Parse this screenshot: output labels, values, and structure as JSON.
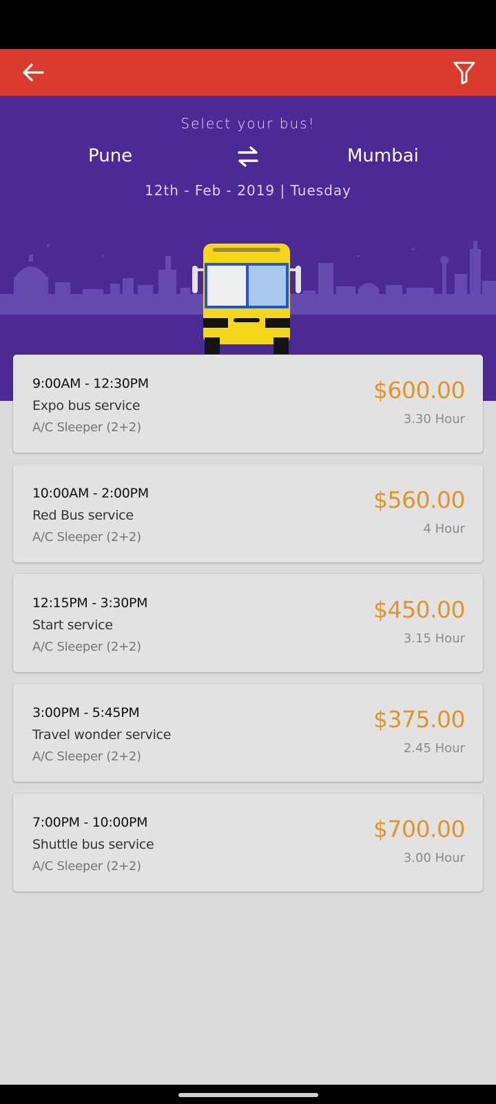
{
  "header": {
    "back_icon": "arrow-left-icon",
    "filter_icon": "filter-funnel-icon",
    "bar_color": "#d93b2f"
  },
  "hero": {
    "subtitle": "Select your bus!",
    "from_city": "Pune",
    "to_city": "Mumbai",
    "swap_icon": "swap-arrows-icon",
    "date": "12th - Feb - 2019 | Tuesday",
    "background_color": "#4b2a96",
    "illustration": "yellow-bus-front-with-city-skyline"
  },
  "buses": [
    {
      "time": "9:00AM - 12:30PM",
      "name": "Expo bus service",
      "type": "A/C Sleeper (2+2)",
      "price": "$600.00",
      "duration": "3.30 Hour"
    },
    {
      "time": "10:00AM - 2:00PM",
      "name": "Red Bus service",
      "type": "A/C Sleeper (2+2)",
      "price": "$560.00",
      "duration": "4 Hour"
    },
    {
      "time": "12:15PM - 3:30PM",
      "name": "Start service",
      "type": "A/C Sleeper (2+2)",
      "price": "$450.00",
      "duration": "3.15 Hour"
    },
    {
      "time": "3:00PM - 5:45PM",
      "name": "Travel wonder service",
      "type": "A/C Sleeper (2+2)",
      "price": "$375.00",
      "duration": "2.45 Hour"
    },
    {
      "time": "7:00PM - 10:00PM",
      "name": "Shuttle bus service",
      "type": "A/C Sleeper (2+2)",
      "price": "$700.00",
      "duration": "3.00 Hour"
    }
  ],
  "colors": {
    "price": "#e0952a",
    "card_background": "#e2e2e2",
    "page_background": "#dcdcdc"
  }
}
